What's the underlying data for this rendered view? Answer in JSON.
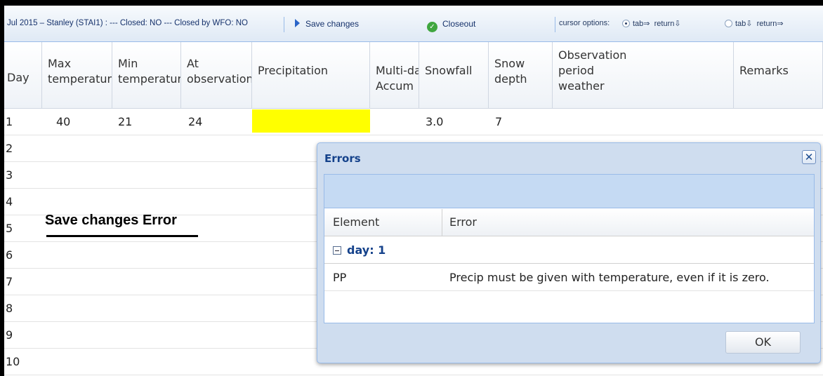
{
  "toolbar": {
    "status": "Jul 2015 – Stanley (STAI1) : --- Closed: NO --- Closed by WFO: NO",
    "save_label": "Save changes",
    "closeout_label": "Closeout",
    "cursor_label": "cursor options:",
    "opt1_tab": "tab⇒",
    "opt1_return": "return⇩",
    "opt2_tab": "tab⇩",
    "opt2_return": "return⇒",
    "selected_option": "tab⇒ return⇩"
  },
  "grid": {
    "columns": [
      {
        "lines": [
          "Day"
        ]
      },
      {
        "lines": [
          "Max",
          "temperature"
        ]
      },
      {
        "lines": [
          "Min",
          "temperature"
        ]
      },
      {
        "lines": [
          "At",
          "observation"
        ]
      },
      {
        "lines": [
          "Precipitation"
        ]
      },
      {
        "lines": [
          "Multi-day",
          "Accum"
        ]
      },
      {
        "lines": [
          "Snowfall"
        ]
      },
      {
        "lines": [
          "Snow",
          "depth"
        ]
      },
      {
        "lines": [
          "Observation",
          "period",
          "weather"
        ]
      },
      {
        "lines": [
          "Remarks"
        ]
      }
    ],
    "rows": [
      {
        "day": "1",
        "max": "40",
        "min": "21",
        "at_obs": "24",
        "snowfall": "3.0",
        "snow_depth": "7"
      },
      {
        "day": "2"
      },
      {
        "day": "3"
      },
      {
        "day": "4"
      },
      {
        "day": "5"
      },
      {
        "day": "6"
      },
      {
        "day": "7"
      },
      {
        "day": "8"
      },
      {
        "day": "9"
      },
      {
        "day": "10"
      }
    ]
  },
  "annotation": "Save changes  Error",
  "errors_dialog": {
    "title": "Errors",
    "close_glyph": "✕",
    "headers": {
      "element": "Element",
      "error": "Error"
    },
    "group_label": "day: 1",
    "row": {
      "element": "PP",
      "error": "Precip must be given with temperature, even if it is zero."
    },
    "ok_label": "OK"
  },
  "colors": {
    "highlight": "#ffff00",
    "toolbar_text": "#15316b",
    "dialog_title": "#15428b",
    "dialog_bg": "#cfddef"
  }
}
